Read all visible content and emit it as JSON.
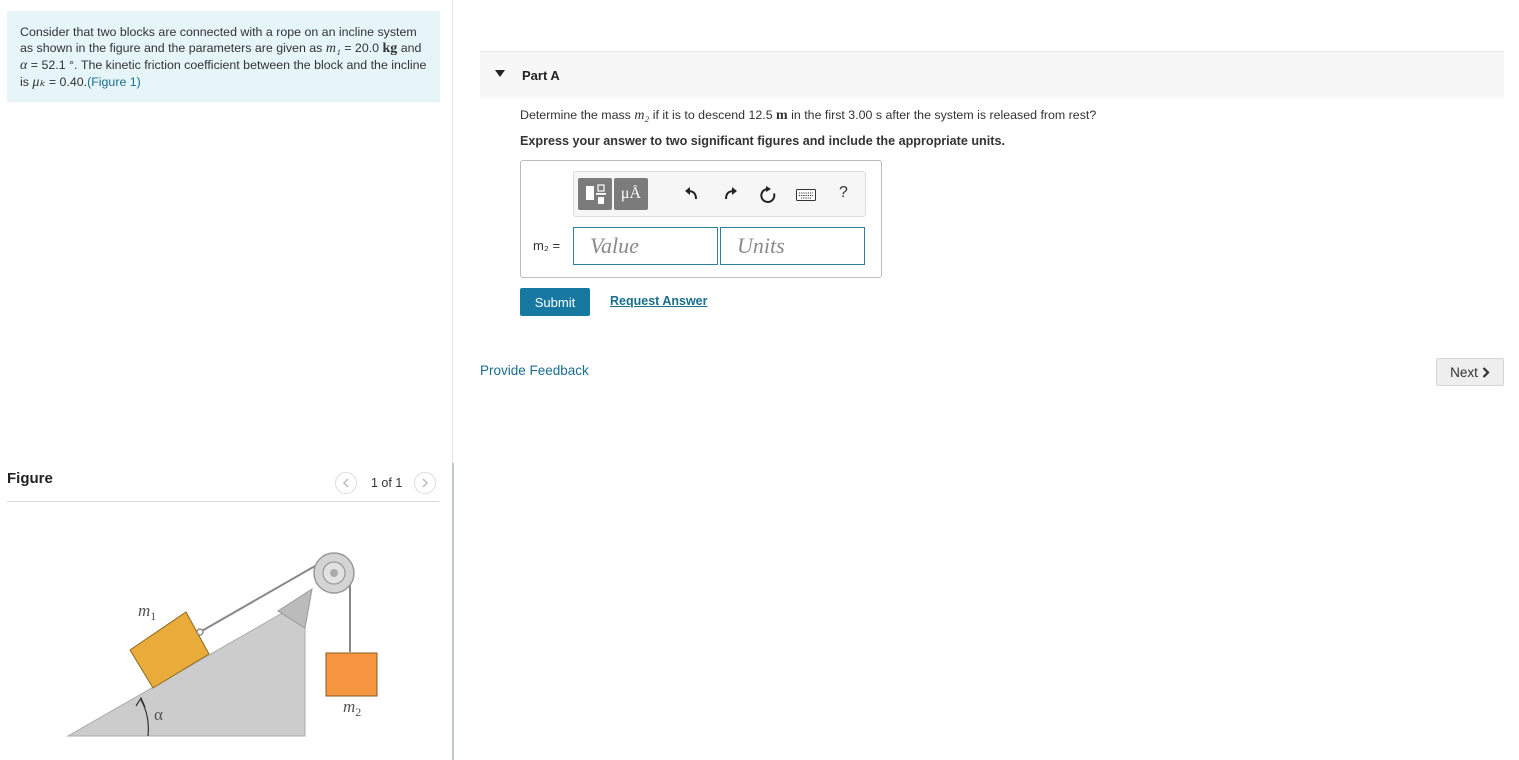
{
  "problem": {
    "t1": "Consider that two blocks are connected with a rope on an incline system as shown in the figure and the parameters are given as ",
    "m1_sym": "m₁",
    "t2": " = 20.0 ",
    "kg": "kg",
    "t3": " and ",
    "alpha_sym": "α",
    "t4": " = 52.1 °. The kinetic friction coefficient between the block and the incline is ",
    "mu_sym": "μₖ",
    "t5": " = 0.40.",
    "figure_link": "(Figure 1)"
  },
  "figure": {
    "title": "Figure",
    "pager": "1 of 1",
    "label_m1": "m",
    "label_m1_sub": "1",
    "label_m2": "m",
    "label_m2_sub": "2",
    "label_alpha": "α",
    "colors": {
      "block1": "#e9ab3a",
      "block2": "#f79640",
      "incline": "#cccccc"
    }
  },
  "part": {
    "title": "Part A",
    "q1": "Determine the mass ",
    "q_sym": "m₂",
    "q2": " if it is to descend 12.5 ",
    "q_unit": "m",
    "q3": " in the first 3.00 s after the system is released from rest?",
    "instruction": "Express your answer to two significant figures and include the appropriate units.",
    "toolbar": {
      "units_button": "μÅ",
      "help": "?"
    },
    "answer_label": "m₂ =",
    "value_placeholder": "Value",
    "units_placeholder": "Units",
    "submit": "Submit",
    "request_answer": "Request Answer"
  },
  "footer": {
    "feedback": "Provide Feedback",
    "next": "Next"
  },
  "colors": {
    "accent": "#1779a1",
    "link": "#1a6e8e",
    "problem_bg": "#e6f5f8"
  }
}
